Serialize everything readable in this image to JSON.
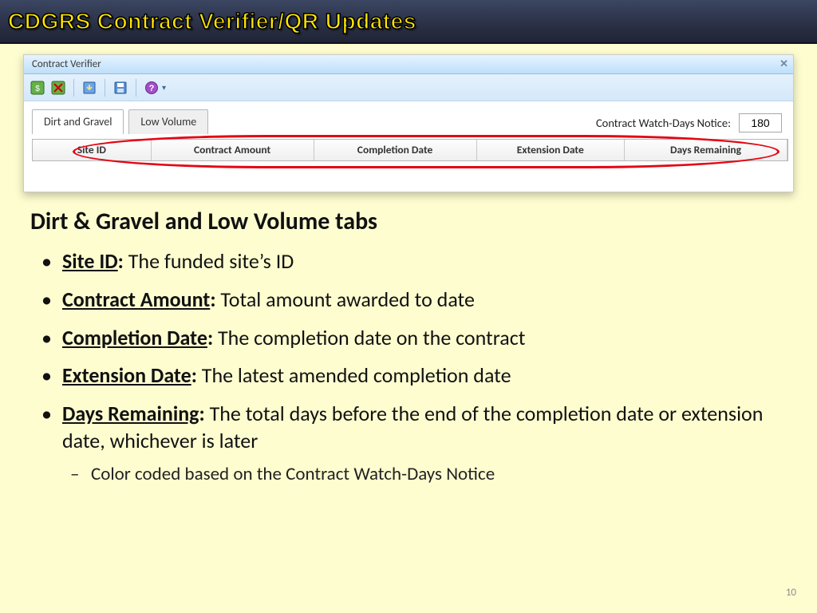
{
  "slide": {
    "title": "CDGRS Contract Verifier/QR Updates",
    "page_number": "10"
  },
  "window": {
    "title": "Contract Verifier",
    "watch_label": "Contract Watch-Days Notice:",
    "watch_value": "180",
    "tabs": [
      {
        "label": "Dirt and Gravel",
        "active": true
      },
      {
        "label": "Low Volume",
        "active": false
      }
    ],
    "columns": {
      "site_id": "Site ID",
      "contract_amount": "Contract Amount",
      "completion_date": "Completion Date",
      "extension_date": "Extension Date",
      "days_remaining": "Days Remaining"
    }
  },
  "content": {
    "heading": "Dirt & Gravel and Low Volume tabs",
    "bullets": [
      {
        "term": "Site ID",
        "desc": "The funded site’s ID"
      },
      {
        "term": "Contract Amount",
        "desc": "Total amount awarded to date"
      },
      {
        "term": "Completion Date",
        "desc": "The completion date on the contract"
      },
      {
        "term": "Extension Date",
        "desc": "The latest amended completion date"
      },
      {
        "term": "Days Remaining",
        "desc": "The total days before the end of the completion date or extension date, whichever is later",
        "sub": "Color coded based on the Contract Watch-Days Notice"
      }
    ]
  }
}
